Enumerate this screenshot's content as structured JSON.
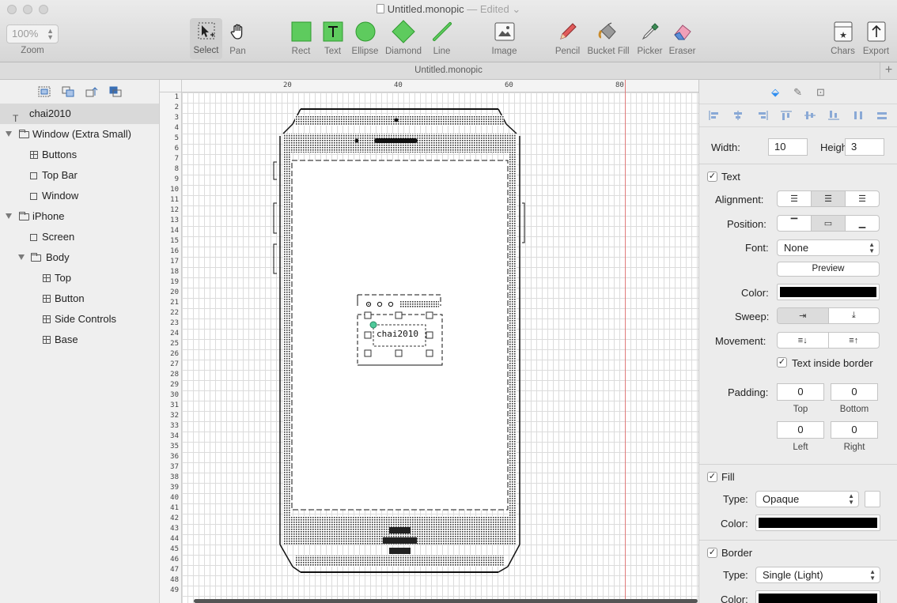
{
  "window": {
    "title": "Untitled.monopic",
    "status": "— Edited",
    "tab_title": "Untitled.monopic",
    "new_tab": "+"
  },
  "toolbar": {
    "zoom_value": "100%",
    "zoom_label": "Zoom",
    "tools": [
      {
        "name": "select",
        "label": "Select"
      },
      {
        "name": "pan",
        "label": "Pan"
      },
      {
        "name": "rect",
        "label": "Rect"
      },
      {
        "name": "text",
        "label": "Text"
      },
      {
        "name": "ellipse",
        "label": "Ellipse"
      },
      {
        "name": "diamond",
        "label": "Diamond"
      },
      {
        "name": "line",
        "label": "Line"
      },
      {
        "name": "image",
        "label": "Image"
      },
      {
        "name": "pencil",
        "label": "Pencil"
      },
      {
        "name": "bucket",
        "label": "Bucket Fill"
      },
      {
        "name": "picker",
        "label": "Picker"
      },
      {
        "name": "eraser",
        "label": "Eraser"
      },
      {
        "name": "chars",
        "label": "Chars"
      },
      {
        "name": "export",
        "label": "Export"
      }
    ],
    "accent_green": "#5ecb5e"
  },
  "sidebar": {
    "items": [
      {
        "label": "chai2010",
        "kind": "text",
        "selected": true
      },
      {
        "label": "Window (Extra Small)",
        "kind": "folder"
      },
      {
        "label": "Buttons",
        "kind": "group"
      },
      {
        "label": "Top Bar",
        "kind": "rect"
      },
      {
        "label": "Window",
        "kind": "rect"
      },
      {
        "label": "iPhone",
        "kind": "folder"
      },
      {
        "label": "Screen",
        "kind": "rect"
      },
      {
        "label": "Body",
        "kind": "folder"
      },
      {
        "label": "Top",
        "kind": "group"
      },
      {
        "label": "Button",
        "kind": "group"
      },
      {
        "label": "Side Controls",
        "kind": "group"
      },
      {
        "label": "Base",
        "kind": "group"
      }
    ]
  },
  "canvas": {
    "ruler_x": [
      "20",
      "40",
      "60",
      "80"
    ],
    "ruler_y": [
      "1",
      "2",
      "3",
      "4",
      "5",
      "6",
      "7",
      "8",
      "9",
      "10",
      "11",
      "12",
      "13",
      "14",
      "15",
      "16",
      "17",
      "18",
      "19",
      "20",
      "21",
      "22",
      "23",
      "24",
      "25",
      "26",
      "27",
      "28",
      "29",
      "30",
      "31",
      "32",
      "33",
      "34",
      "35",
      "36",
      "37",
      "38",
      "39",
      "40",
      "41",
      "42",
      "43",
      "44",
      "45",
      "46",
      "47",
      "48",
      "49"
    ],
    "selected_text": "chai2010",
    "margin_line_color": "#e07b7b"
  },
  "inspector": {
    "width_label": "Width:",
    "width_value": "10",
    "height_label": "Height:",
    "height_value": "3",
    "text_section": "Text",
    "alignment_label": "Alignment:",
    "position_label": "Position:",
    "font_label": "Font:",
    "font_value": "None",
    "preview_button": "Preview",
    "color_label": "Color:",
    "text_color": "#000000",
    "sweep_label": "Sweep:",
    "movement_label": "Movement:",
    "text_inside_border": "Text inside border",
    "padding_label": "Padding:",
    "padding_top": "0",
    "padding_bottom": "0",
    "padding_left": "0",
    "padding_right": "0",
    "top_label": "Top",
    "bottom_label": "Bottom",
    "left_label": "Left",
    "right_label": "Right",
    "fill_section": "Fill",
    "type_label": "Type:",
    "fill_type": "Opaque",
    "fill_color_label": "Color:",
    "fill_color": "#000000",
    "border_section": "Border",
    "border_type_label": "Type:",
    "border_type": "Single (Light)",
    "border_color_label": "Color:"
  }
}
